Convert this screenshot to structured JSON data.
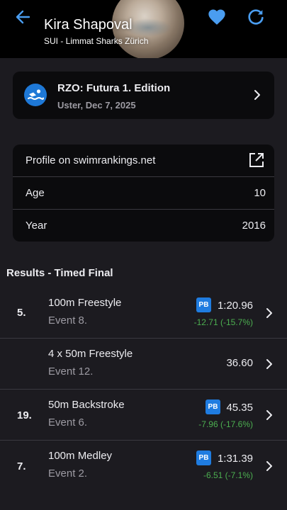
{
  "header": {
    "athlete_name": "Kira Shapoval",
    "club": "SUI - Limmat Sharks Zürich",
    "back_icon": "arrow-left-icon",
    "favorite_icon": "heart-icon",
    "refresh_icon": "refresh-icon"
  },
  "meet": {
    "title": "RZO: Futura 1. Edition",
    "subtitle": "Uster, Dec 7, 2025",
    "logo_icon": "swimmer-icon"
  },
  "info": {
    "profile_label": "Profile on swimrankings.net",
    "profile_icon": "open-external-icon",
    "age_label": "Age",
    "age_value": "10",
    "year_label": "Year",
    "year_value": "2016"
  },
  "results": {
    "section_title": "Results - Timed Final",
    "items": [
      {
        "rank": "5.",
        "event": "100m Freestyle",
        "event_number": "Event 8.",
        "pb": "PB",
        "time": "1:20.96",
        "diff": "-12.71 (-15.7%)"
      },
      {
        "rank": "",
        "event": "4 x 50m Freestyle",
        "event_number": "Event 12.",
        "pb": "",
        "time": "36.60",
        "diff": ""
      },
      {
        "rank": "19.",
        "event": "50m Backstroke",
        "event_number": "Event 6.",
        "pb": "PB",
        "time": "45.35",
        "diff": "-7.96 (-17.6%)"
      },
      {
        "rank": "7.",
        "event": "100m Medley",
        "event_number": "Event 2.",
        "pb": "PB",
        "time": "1:31.39",
        "diff": "-6.51 (-7.1%)"
      }
    ]
  },
  "colors": {
    "accent": "#4a9df0",
    "background": "#1c1b20",
    "card": "#0b0b0d",
    "pb_badge": "#1f7ce0",
    "improvement": "#4caf50"
  }
}
